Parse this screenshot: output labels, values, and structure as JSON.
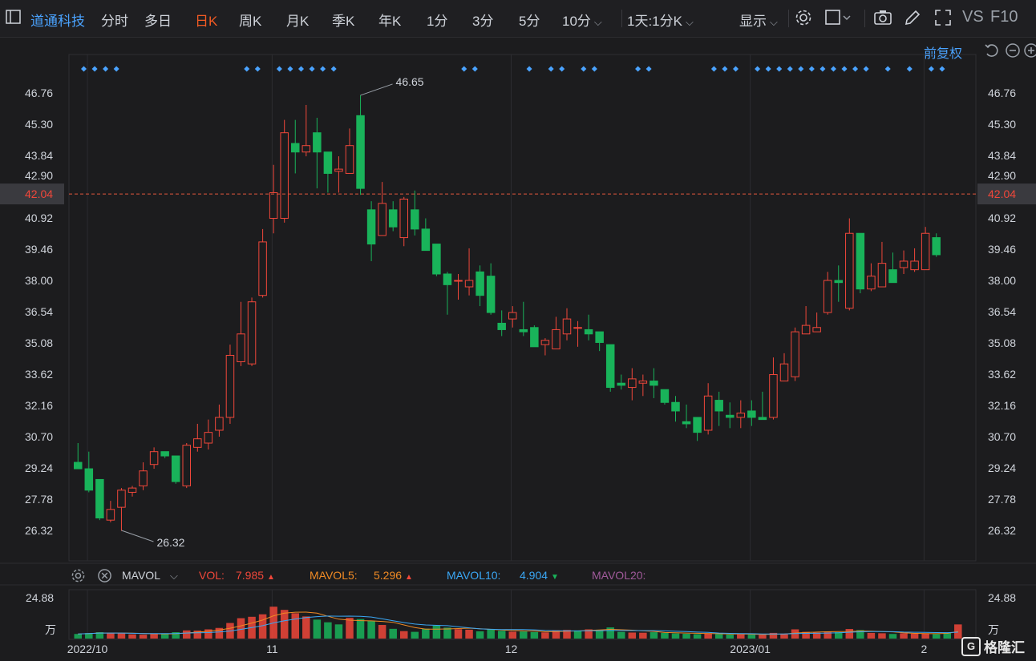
{
  "toolbar": {
    "panel_icon": "panel-icon",
    "stock_name": "道通科技",
    "periods": [
      "分时",
      "多日",
      "日K",
      "周K",
      "月K",
      "季K",
      "年K",
      "1分",
      "3分",
      "5分",
      "10分"
    ],
    "active_period": "日K",
    "combo": "1天:1分K",
    "display": "显示",
    "vs": "VS",
    "f10": "F10"
  },
  "adjust": {
    "label": "前复权"
  },
  "colors": {
    "up": "#f0473a",
    "down": "#19b35a",
    "marker": "#4aa3ff",
    "current_line": "#e3573d",
    "background": "#1c1c1e"
  },
  "indicator": {
    "name": "MAVOL",
    "vol_label": "VOL:",
    "vol_value": "7.985",
    "mavol5_label": "MAVOL5:",
    "mavol5_value": "5.296",
    "mavol10_label": "MAVOL10:",
    "mavol10_value": "4.904",
    "mavol20_label": "MAVOL20:",
    "vol_axis_top": "24.88",
    "vol_axis_unit": "万"
  },
  "watermark": "格隆汇",
  "chart_data": {
    "type": "candlestick",
    "y_ticks": [
      "46.76",
      "45.30",
      "43.84",
      "42.90",
      "40.92",
      "39.46",
      "38.00",
      "36.54",
      "35.08",
      "33.62",
      "32.16",
      "30.70",
      "29.24",
      "27.78",
      "26.32"
    ],
    "ylim": [
      25.6,
      47.9
    ],
    "current_price": 42.04,
    "x_labels": [
      {
        "label": "2022/10",
        "index": 1
      },
      {
        "label": "11",
        "index": 18
      },
      {
        "label": "12",
        "index": 40
      },
      {
        "label": "2023/01",
        "index": 62
      },
      {
        "label": "2",
        "index": 78
      }
    ],
    "annotations": [
      {
        "text": "46.65",
        "index": 26,
        "value": 46.65,
        "kind": "high"
      },
      {
        "text": "26.32",
        "index": 4,
        "value": 26.32,
        "kind": "low"
      }
    ],
    "marker_indices": [
      0,
      1,
      2,
      3,
      15,
      16,
      18,
      19,
      20,
      21,
      22,
      23,
      35,
      36,
      41,
      43,
      44,
      46,
      47,
      51,
      52,
      58,
      59,
      60,
      62,
      63,
      64,
      65,
      66,
      67,
      68,
      69,
      70,
      71,
      72,
      74,
      76,
      78,
      79
    ],
    "candles": [
      [
        29.5,
        29.2,
        30.4,
        29.2
      ],
      [
        29.2,
        28.2,
        30.0,
        28.1
      ],
      [
        28.7,
        26.9,
        28.7,
        26.8
      ],
      [
        26.8,
        27.3,
        27.7,
        26.7
      ],
      [
        27.4,
        28.2,
        28.3,
        26.3
      ],
      [
        28.1,
        28.3,
        28.4,
        27.9
      ],
      [
        28.4,
        29.1,
        29.5,
        28.2
      ],
      [
        29.4,
        30.0,
        30.2,
        29.2
      ],
      [
        30.0,
        29.8,
        30.0,
        29.7
      ],
      [
        29.8,
        28.6,
        29.8,
        28.5
      ],
      [
        28.4,
        30.3,
        30.4,
        28.3
      ],
      [
        30.2,
        30.6,
        31.3,
        30.0
      ],
      [
        30.4,
        30.9,
        31.5,
        30.1
      ],
      [
        31.0,
        31.6,
        32.2,
        30.7
      ],
      [
        31.6,
        34.5,
        35.0,
        31.3
      ],
      [
        34.2,
        35.5,
        37.0,
        34.0
      ],
      [
        34.1,
        37.0,
        37.2,
        34.0
      ],
      [
        37.3,
        39.8,
        40.4,
        37.2
      ],
      [
        40.9,
        42.1,
        43.4,
        40.2
      ],
      [
        40.9,
        44.9,
        45.5,
        40.7
      ],
      [
        44.4,
        44.0,
        45.5,
        43.0
      ],
      [
        44.0,
        44.3,
        46.2,
        43.8
      ],
      [
        44.9,
        44.0,
        45.6,
        42.3
      ],
      [
        44.0,
        43.0,
        44.0,
        42.1
      ],
      [
        43.1,
        43.2,
        43.8,
        42.1
      ],
      [
        43.0,
        44.3,
        45.1,
        43.0
      ],
      [
        45.7,
        42.3,
        46.65,
        42.0
      ],
      [
        41.3,
        39.7,
        41.7,
        38.9
      ],
      [
        40.1,
        41.6,
        42.6,
        40.1
      ],
      [
        41.3,
        40.5,
        41.7,
        40.3
      ],
      [
        40.0,
        41.8,
        41.9,
        39.6
      ],
      [
        41.3,
        40.4,
        42.2,
        40.1
      ],
      [
        40.4,
        39.4,
        40.9,
        39.4
      ],
      [
        39.7,
        38.3,
        39.7,
        38.2
      ],
      [
        38.3,
        37.8,
        38.4,
        36.4
      ],
      [
        38.0,
        38.0,
        38.3,
        37.1
      ],
      [
        37.7,
        38.0,
        39.5,
        37.3
      ],
      [
        38.4,
        37.3,
        38.7,
        36.8
      ],
      [
        38.2,
        36.5,
        38.8,
        36.4
      ],
      [
        36.0,
        35.7,
        36.6,
        35.4
      ],
      [
        36.2,
        36.5,
        36.8,
        35.8
      ],
      [
        35.7,
        35.6,
        37.0,
        35.4
      ],
      [
        35.8,
        34.9,
        35.9,
        34.9
      ],
      [
        35.0,
        35.2,
        35.3,
        34.5
      ],
      [
        34.8,
        35.7,
        36.3,
        34.8
      ],
      [
        35.5,
        36.2,
        36.7,
        35.2
      ],
      [
        35.8,
        35.8,
        36.1,
        34.9
      ],
      [
        35.7,
        35.5,
        36.4,
        35.2
      ],
      [
        35.6,
        35.1,
        35.6,
        34.7
      ],
      [
        35.0,
        33.0,
        35.0,
        32.8
      ],
      [
        33.2,
        33.1,
        33.6,
        32.9
      ],
      [
        33.0,
        33.4,
        33.9,
        32.4
      ],
      [
        33.2,
        33.3,
        33.6,
        32.6
      ],
      [
        33.3,
        33.1,
        33.9,
        32.5
      ],
      [
        32.9,
        32.3,
        32.9,
        32.2
      ],
      [
        32.3,
        31.9,
        32.6,
        31.4
      ],
      [
        31.4,
        31.3,
        32.2,
        31.1
      ],
      [
        31.6,
        30.9,
        31.6,
        30.5
      ],
      [
        31.0,
        32.6,
        33.2,
        30.8
      ],
      [
        32.4,
        31.9,
        32.8,
        31.2
      ],
      [
        31.7,
        31.6,
        32.3,
        31.1
      ],
      [
        31.6,
        31.8,
        32.4,
        31.1
      ],
      [
        31.9,
        31.6,
        32.4,
        31.2
      ],
      [
        31.6,
        31.5,
        32.8,
        31.5
      ],
      [
        31.6,
        33.6,
        34.4,
        31.5
      ],
      [
        33.3,
        34.1,
        34.6,
        33.3
      ],
      [
        33.5,
        35.6,
        35.8,
        33.3
      ],
      [
        35.5,
        35.9,
        36.8,
        35.5
      ],
      [
        35.6,
        35.8,
        36.5,
        35.6
      ],
      [
        36.5,
        38.0,
        38.4,
        36.4
      ],
      [
        38.0,
        37.9,
        38.7,
        37.0
      ],
      [
        36.7,
        40.2,
        40.9,
        36.6
      ],
      [
        40.2,
        37.6,
        40.1,
        37.4
      ],
      [
        37.6,
        38.2,
        38.8,
        37.5
      ],
      [
        37.7,
        38.8,
        39.8,
        37.8
      ],
      [
        38.5,
        37.9,
        39.3,
        37.9
      ],
      [
        38.6,
        38.9,
        39.4,
        38.3
      ],
      [
        38.5,
        38.9,
        39.5,
        38.4
      ],
      [
        38.5,
        40.2,
        40.5,
        38.5
      ],
      [
        40.0,
        39.2,
        40.2,
        39.1
      ]
    ],
    "volumes": [
      [
        2.6,
        "d"
      ],
      [
        3.1,
        "d"
      ],
      [
        3.6,
        "d"
      ],
      [
        3.2,
        "u"
      ],
      [
        3.0,
        "u"
      ],
      [
        2.4,
        "u"
      ],
      [
        2.2,
        "u"
      ],
      [
        2.8,
        "u"
      ],
      [
        2.6,
        "d"
      ],
      [
        3.6,
        "d"
      ],
      [
        4.6,
        "u"
      ],
      [
        4.5,
        "u"
      ],
      [
        5.2,
        "u"
      ],
      [
        6.0,
        "u"
      ],
      [
        8.8,
        "u"
      ],
      [
        11.5,
        "u"
      ],
      [
        12.3,
        "u"
      ],
      [
        13.7,
        "u"
      ],
      [
        18.0,
        "u"
      ],
      [
        16.2,
        "u"
      ],
      [
        14.3,
        "u"
      ],
      [
        12.5,
        "u"
      ],
      [
        10.7,
        "d"
      ],
      [
        9.2,
        "d"
      ],
      [
        8.0,
        "d"
      ],
      [
        11.7,
        "u"
      ],
      [
        11.0,
        "d"
      ],
      [
        10.0,
        "d"
      ],
      [
        7.7,
        "u"
      ],
      [
        5.5,
        "d"
      ],
      [
        4.2,
        "u"
      ],
      [
        3.8,
        "d"
      ],
      [
        5.6,
        "d"
      ],
      [
        7.3,
        "d"
      ],
      [
        6.2,
        "d"
      ],
      [
        5.3,
        "u"
      ],
      [
        5.0,
        "u"
      ],
      [
        4.1,
        "d"
      ],
      [
        5.4,
        "d"
      ],
      [
        4.4,
        "d"
      ],
      [
        3.9,
        "u"
      ],
      [
        4.0,
        "d"
      ],
      [
        3.7,
        "d"
      ],
      [
        3.5,
        "u"
      ],
      [
        4.7,
        "u"
      ],
      [
        4.9,
        "u"
      ],
      [
        4.6,
        "d"
      ],
      [
        5.2,
        "u"
      ],
      [
        5.0,
        "d"
      ],
      [
        6.3,
        "d"
      ],
      [
        3.8,
        "d"
      ],
      [
        3.4,
        "u"
      ],
      [
        3.3,
        "u"
      ],
      [
        3.6,
        "d"
      ],
      [
        3.2,
        "d"
      ],
      [
        2.9,
        "d"
      ],
      [
        2.7,
        "d"
      ],
      [
        2.5,
        "d"
      ],
      [
        3.0,
        "u"
      ],
      [
        2.6,
        "d"
      ],
      [
        2.3,
        "d"
      ],
      [
        2.4,
        "u"
      ],
      [
        2.2,
        "d"
      ],
      [
        2.1,
        "u"
      ],
      [
        3.2,
        "u"
      ],
      [
        2.8,
        "u"
      ],
      [
        5.2,
        "u"
      ],
      [
        3.8,
        "u"
      ],
      [
        3.4,
        "u"
      ],
      [
        4.0,
        "u"
      ],
      [
        3.6,
        "d"
      ],
      [
        5.4,
        "u"
      ],
      [
        4.8,
        "d"
      ],
      [
        3.2,
        "u"
      ],
      [
        3.0,
        "u"
      ],
      [
        2.6,
        "d"
      ],
      [
        3.0,
        "u"
      ],
      [
        2.8,
        "u"
      ],
      [
        2.9,
        "u"
      ],
      [
        2.5,
        "d"
      ],
      [
        3.4,
        "d"
      ],
      [
        7.985,
        "u"
      ]
    ],
    "vol_ylim": [
      0,
      24.88
    ]
  }
}
